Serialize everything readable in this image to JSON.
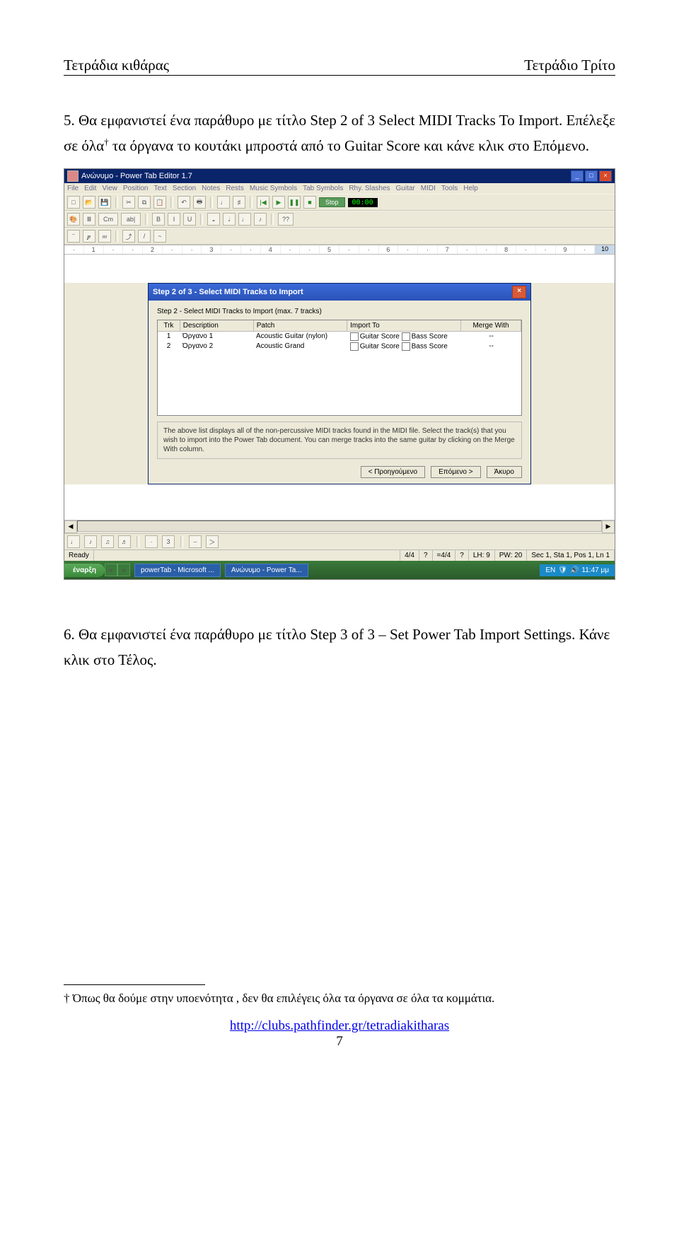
{
  "header": {
    "left": "Τετράδια κιθάρας",
    "right": "Τετράδιο Τρίτο"
  },
  "p1": "5. Θα εμφανιστεί ένα παράθυρο με τίτλο Step 2 of 3 Select MIDI Tracks To Import. Επέλεξε σε όλα",
  "p1b": " τα όργανα το κουτάκι μπροστά από το Guitar Score και κάνε κλικ στο Επόμενο.",
  "dagger": "†",
  "p2": "6. Θα εμφανιστεί ένα παράθυρο με τίτλο Step 3 of 3 – Set Power Tab Import Settings. Κάνε κλικ στο Τέλος.",
  "footnote": "† Όπως θα δούμε στην υποενότητα , δεν θα επιλέγεις όλα τα όργανα σε όλα τα κομμάτια.",
  "footer": {
    "url": "http://clubs.pathfinder.gr/tetradiakitharas",
    "page": "7"
  },
  "shot": {
    "title": "Ανώνυμο - Power Tab Editor 1.7",
    "menu": [
      "File",
      "Edit",
      "View",
      "Position",
      "Text",
      "Section",
      "Notes",
      "Rests",
      "Music Symbols",
      "Tab Symbols",
      "Rhy. Slashes",
      "Guitar",
      "MIDI",
      "Tools",
      "Help"
    ],
    "stop": "Stop",
    "time": "00:00",
    "tb2": [
      "Cm",
      "ab|",
      "B",
      "I",
      "U",
      "??"
    ],
    "ruler": [
      "·",
      "1",
      "·",
      "·",
      "2",
      "·",
      "·",
      "3",
      "·",
      "·",
      "4",
      "·",
      "·",
      "5",
      "·",
      "·",
      "6",
      "·",
      "·",
      "7",
      "·",
      "·",
      "8",
      "·",
      "·",
      "9",
      "·"
    ],
    "rend": "10",
    "dialog": {
      "title": "Step 2 of 3 - Select MIDI Tracks to Import",
      "label": "Step 2 - Select MIDI Tracks to Import (max. 7 tracks)",
      "headers": [
        "Trk",
        "Description",
        "Patch",
        "Import To",
        "Merge With"
      ],
      "rows": [
        {
          "trk": "1",
          "desc": "Όργανο 1",
          "patch": "Acoustic Guitar (nylon)",
          "imp1": "Guitar Score",
          "imp2": "Bass Score",
          "merge": "--"
        },
        {
          "trk": "2",
          "desc": "Όργανο 2",
          "patch": "Acoustic Grand",
          "imp1": "Guitar Score",
          "imp2": "Bass Score",
          "merge": "--"
        }
      ],
      "hint": "The above list displays all of the non-percussive MIDI tracks found in the MIDI file. Select the track(s) that you wish to import into the Power Tab document. You can merge tracks into the same guitar by clicking on the Merge With column.",
      "btns": [
        "< Προηγούμενο",
        "Επόμενο >",
        "Άκυρο"
      ]
    },
    "status": {
      "ready": "Ready",
      "ts1": "4/4",
      "ts2": "?",
      "ts3": "=4/4",
      "ts4": "?",
      "lh": "LH: 9",
      "pw": "PW: 20",
      "pos": "Sec 1, Sta 1, Pos 1, Ln 1"
    },
    "task": {
      "start": "έναρξη",
      "items": [
        "powerTab - Microsoft ...",
        "Ανώνυμο - Power Ta..."
      ],
      "tray": "EN",
      "clock": "11:47 μμ"
    }
  }
}
